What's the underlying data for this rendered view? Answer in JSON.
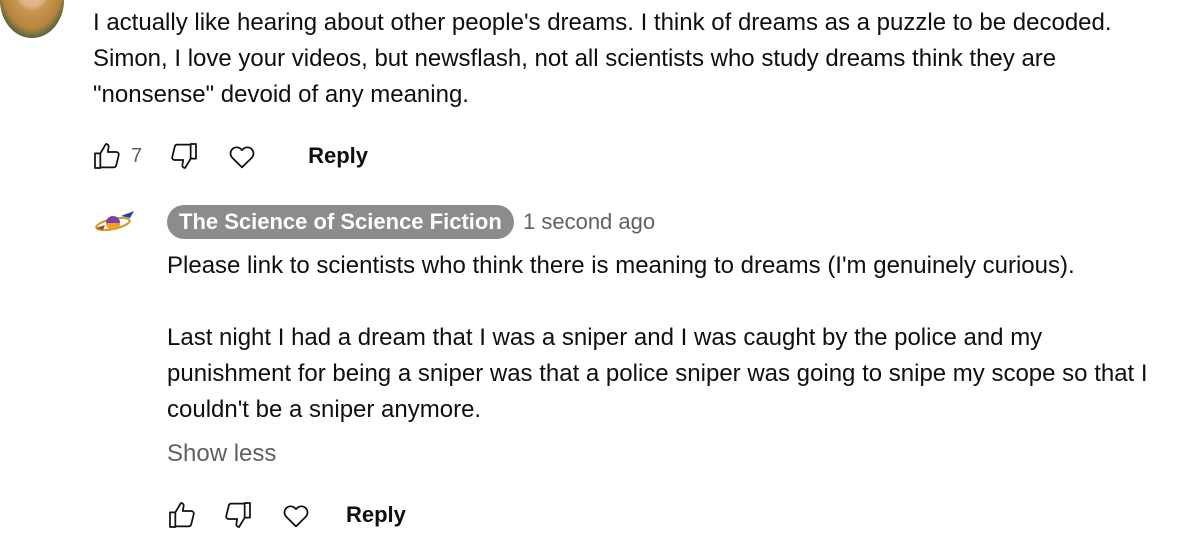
{
  "top_comment": {
    "text": "I actually like hearing about other people's dreams. I think of dreams as a puzzle to be decoded. Simon, I love your videos, but newsflash, not all scientists who study dreams think they are \"nonsense\" devoid of any meaning.",
    "lines": [
      "I actually like hearing about other people's dreams. I think of dreams as a puzzle to be decoded.",
      "Simon, I love your videos, but newsflash, not all scientists who study dreams think they are",
      "\"nonsense\" devoid of any meaning."
    ],
    "like_count": "7",
    "reply_label": "Reply"
  },
  "reply_comment": {
    "channel_name": "The Science of Science Fiction",
    "timestamp": "1 second ago",
    "paragraph1": "Please link to scientists who think there is meaning to dreams (I'm genuinely curious).",
    "paragraph2_lines": [
      "Last night I had a dream that I was a sniper and I was caught by the police and my",
      "punishment for being a sniper was that a police sniper was going to snipe my scope so that I",
      "couldn't be a sniper anymore."
    ],
    "show_less_label": "Show less",
    "reply_label": "Reply"
  },
  "icons": [
    "thumbs-up-icon",
    "thumbs-down-icon",
    "heart-icon",
    "channel-logo-icon"
  ],
  "colors": {
    "chip_bg": "#8c8c8c",
    "secondary_text": "#606060",
    "primary_text": "#0f0f0f"
  }
}
